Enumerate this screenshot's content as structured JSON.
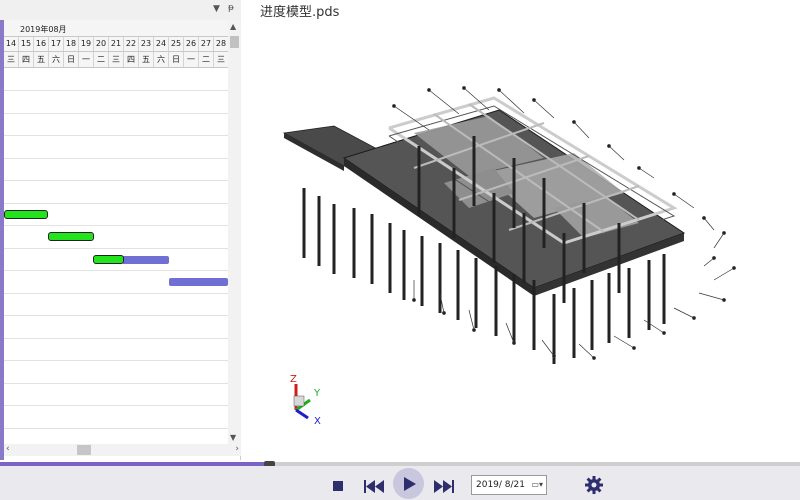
{
  "gantt": {
    "month": "2019年08月",
    "days": [
      "14",
      "15",
      "16",
      "17",
      "18",
      "19",
      "20",
      "21",
      "22",
      "23",
      "24",
      "25",
      "26",
      "27",
      "28"
    ],
    "weekdays": [
      "三",
      "四",
      "五",
      "六",
      "日",
      "一",
      "二",
      "三",
      "四",
      "五",
      "六",
      "日",
      "一",
      "二",
      "三"
    ]
  },
  "model": {
    "title": "进度模型.pds"
  },
  "axes": {
    "z": "Z",
    "y": "Y",
    "x": "X"
  },
  "playback": {
    "date": "2019/  8/21",
    "progress": 0.33
  },
  "colors": {
    "accent": "#7b62c4",
    "done_bar": "#22e31c",
    "planned_bar": "#6f6fd4"
  },
  "icons": [
    "pin-icon",
    "dropdown-icon",
    "stop-icon",
    "skip-back-icon",
    "play-icon",
    "skip-forward-icon",
    "calendar-icon",
    "gear-icon"
  ]
}
